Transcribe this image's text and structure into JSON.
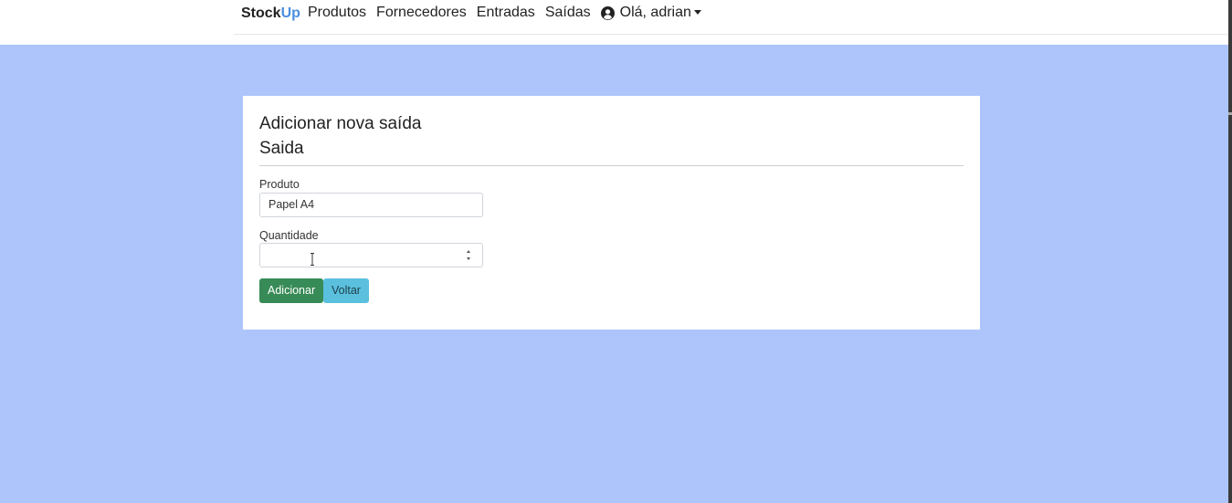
{
  "navbar": {
    "brand_a": "Stock",
    "brand_b": "Up",
    "links": [
      "Produtos",
      "Fornecedores",
      "Entradas",
      "Saídas"
    ],
    "user_menu": "Olá, adrian",
    "user_icon": "user-circle-icon"
  },
  "card": {
    "title": "Adicionar nova saída",
    "subtitle": "Saida",
    "fields": {
      "produto_label": "Produto",
      "produto_value": "Papel A4",
      "quantidade_label": "Quantidade",
      "quantidade_value": ""
    },
    "buttons": {
      "add": "Adicionar",
      "back": "Voltar"
    }
  },
  "colors": {
    "background": "#aec5fb",
    "brand_accent": "#4a8fe0",
    "add_button": "#378b56",
    "back_button": "#5bc0de"
  }
}
